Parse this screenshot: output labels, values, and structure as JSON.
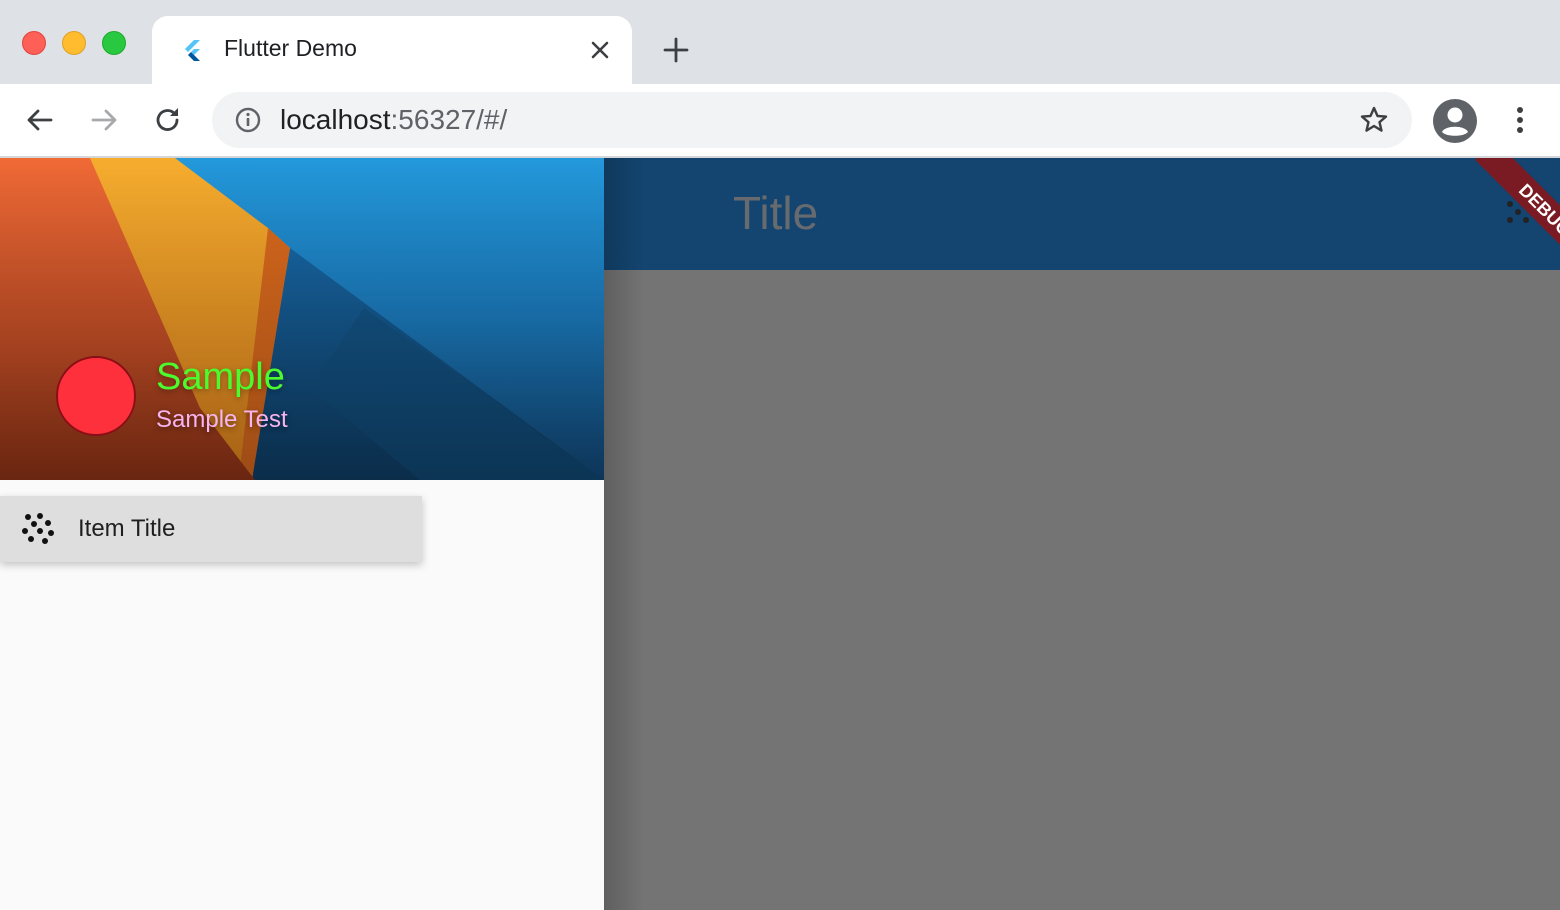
{
  "browser": {
    "tab": {
      "title": "Flutter Demo",
      "favicon_icon": "flutter-logo-icon",
      "close_icon": "close-icon"
    },
    "new_tab_icon": "plus-icon",
    "nav": {
      "back_icon": "arrow-left-icon",
      "forward_icon": "arrow-right-icon",
      "reload_icon": "reload-icon"
    },
    "omnibox": {
      "info_icon": "info-icon",
      "host": "localhost",
      "rest": ":56327/#/",
      "bookmark_icon": "star-icon"
    },
    "profile_icon": "account-circle-icon",
    "menu_icon": "more-vert-icon"
  },
  "app": {
    "appbar": {
      "title": "Title",
      "color": "#134570"
    },
    "drawer": {
      "header": {
        "account_name": "Sample",
        "account_email": "Sample Test",
        "avatar_color": "#fd303c",
        "name_color": "#4bfb2e",
        "email_color": "#f7b4ee"
      },
      "items": [
        {
          "label": "Item Title",
          "icon": "dots-pattern-icon"
        }
      ]
    },
    "debug_banner": "DEBUG"
  }
}
